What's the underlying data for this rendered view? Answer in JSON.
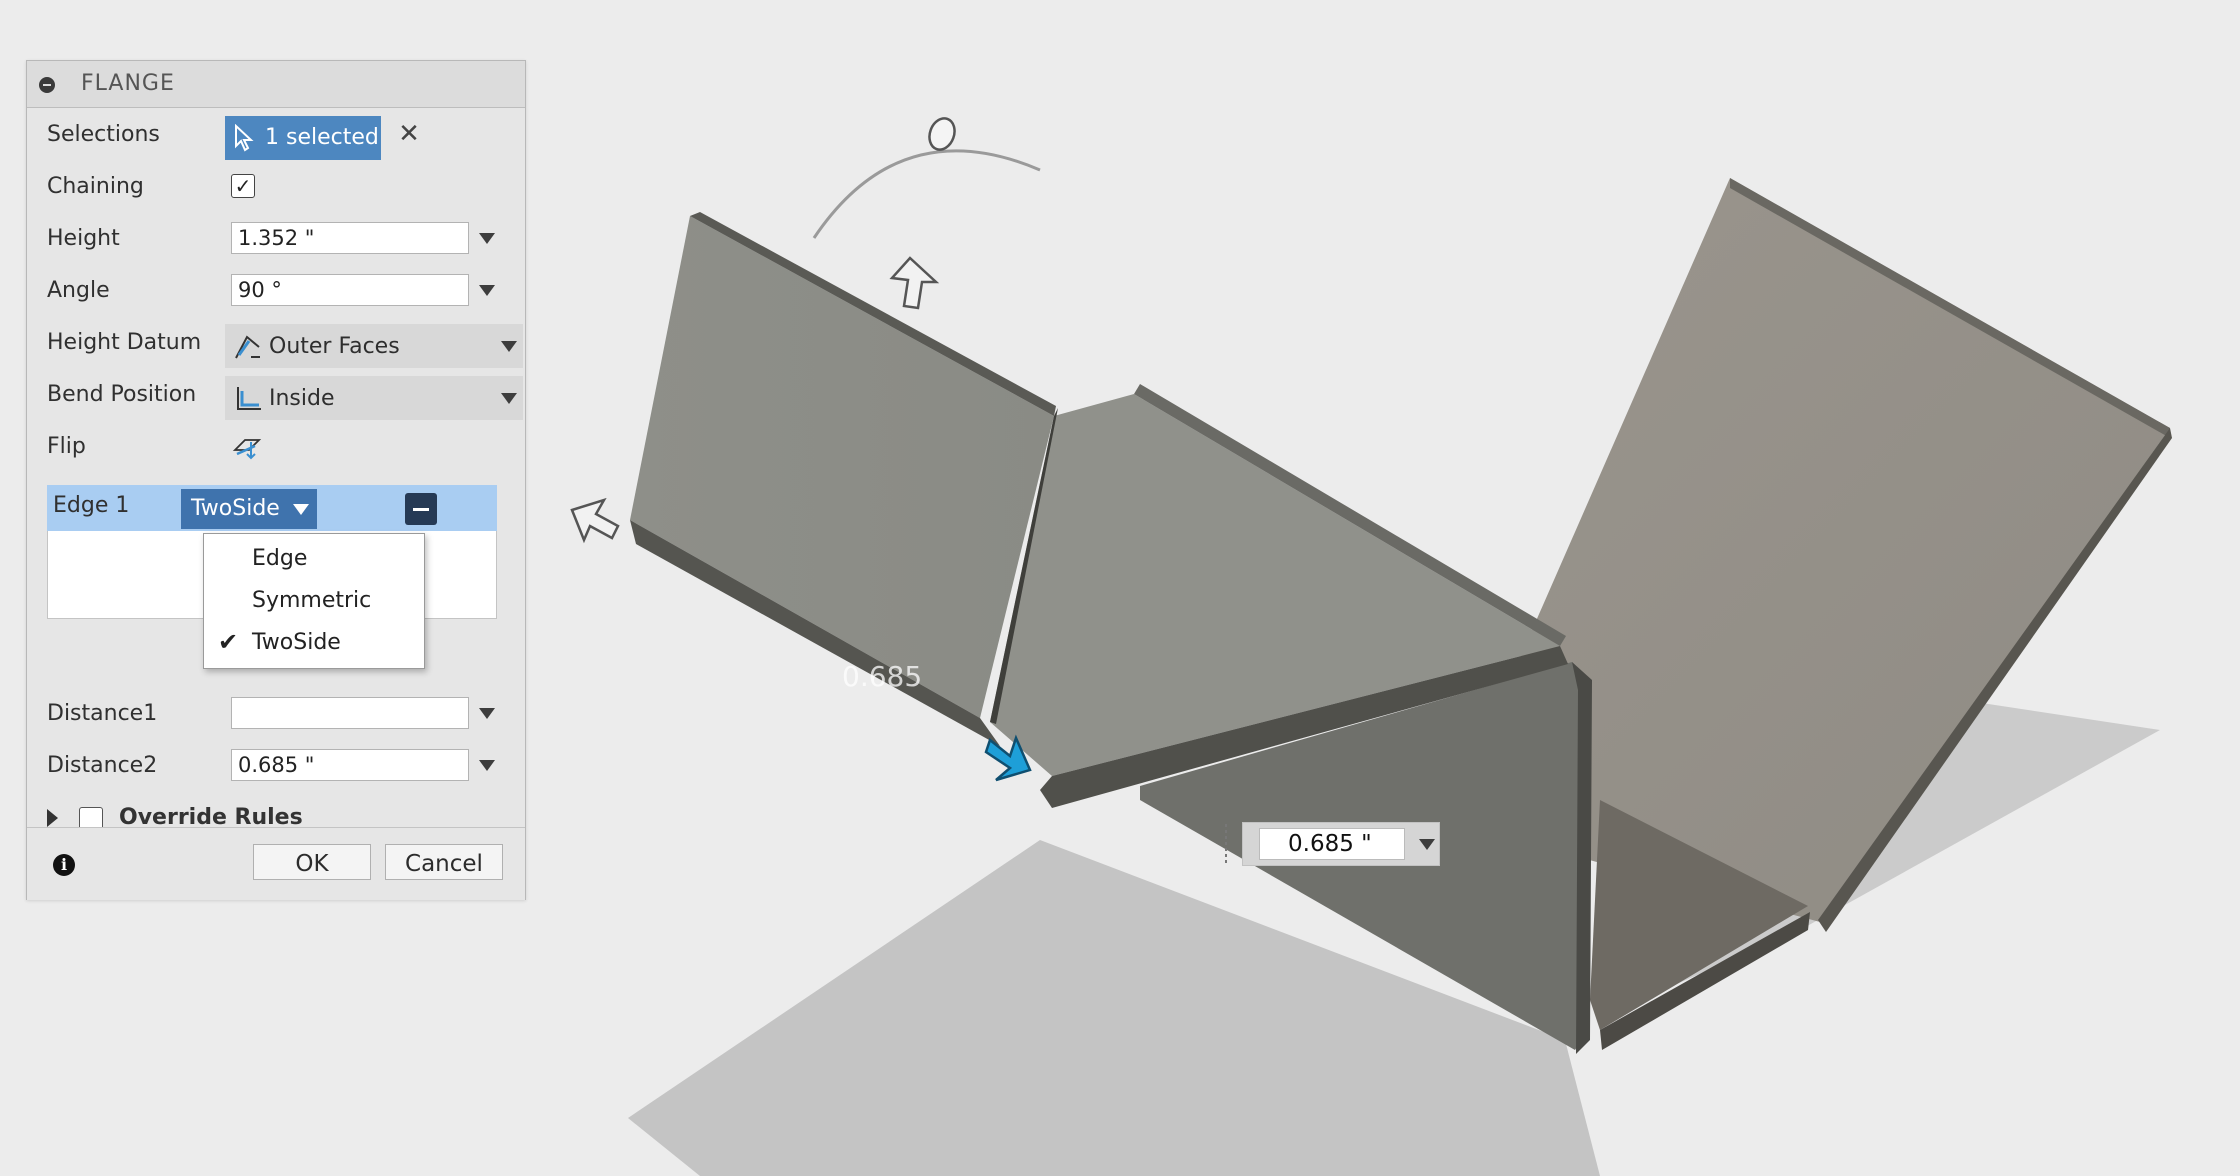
{
  "panel": {
    "title": "FLANGE",
    "selections": {
      "label": "Selections",
      "button": "1 selected"
    },
    "chaining": {
      "label": "Chaining",
      "checked": true
    },
    "height": {
      "label": "Height",
      "value": "1.352 \""
    },
    "angle": {
      "label": "Angle",
      "value": "90 °"
    },
    "height_datum": {
      "label": "Height Datum",
      "value": "Outer Faces"
    },
    "bend_position": {
      "label": "Bend Position",
      "value": "Inside"
    },
    "flip": {
      "label": "Flip"
    },
    "edge": {
      "label": "Edge 1",
      "type": "TwoSide"
    },
    "extent_menu": {
      "options": [
        "Edge",
        "Symmetric",
        "TwoSide"
      ],
      "selected": "TwoSide"
    },
    "distance1": {
      "label": "Distance1"
    },
    "distance2": {
      "label": "Distance2",
      "value": "0.685 \""
    },
    "override_rules": {
      "label": "Override Rules",
      "checked": false
    },
    "ok_label": "OK",
    "cancel_label": "Cancel"
  },
  "viewport": {
    "ghost_dimension": "0.685",
    "distance_input_value": "0.685 \""
  },
  "colors": {
    "accent": "#4d87c0",
    "edge_row_highlight": "#a9cdf2",
    "manipulator_blue": "#1e9fd8",
    "background": "#ececec"
  }
}
